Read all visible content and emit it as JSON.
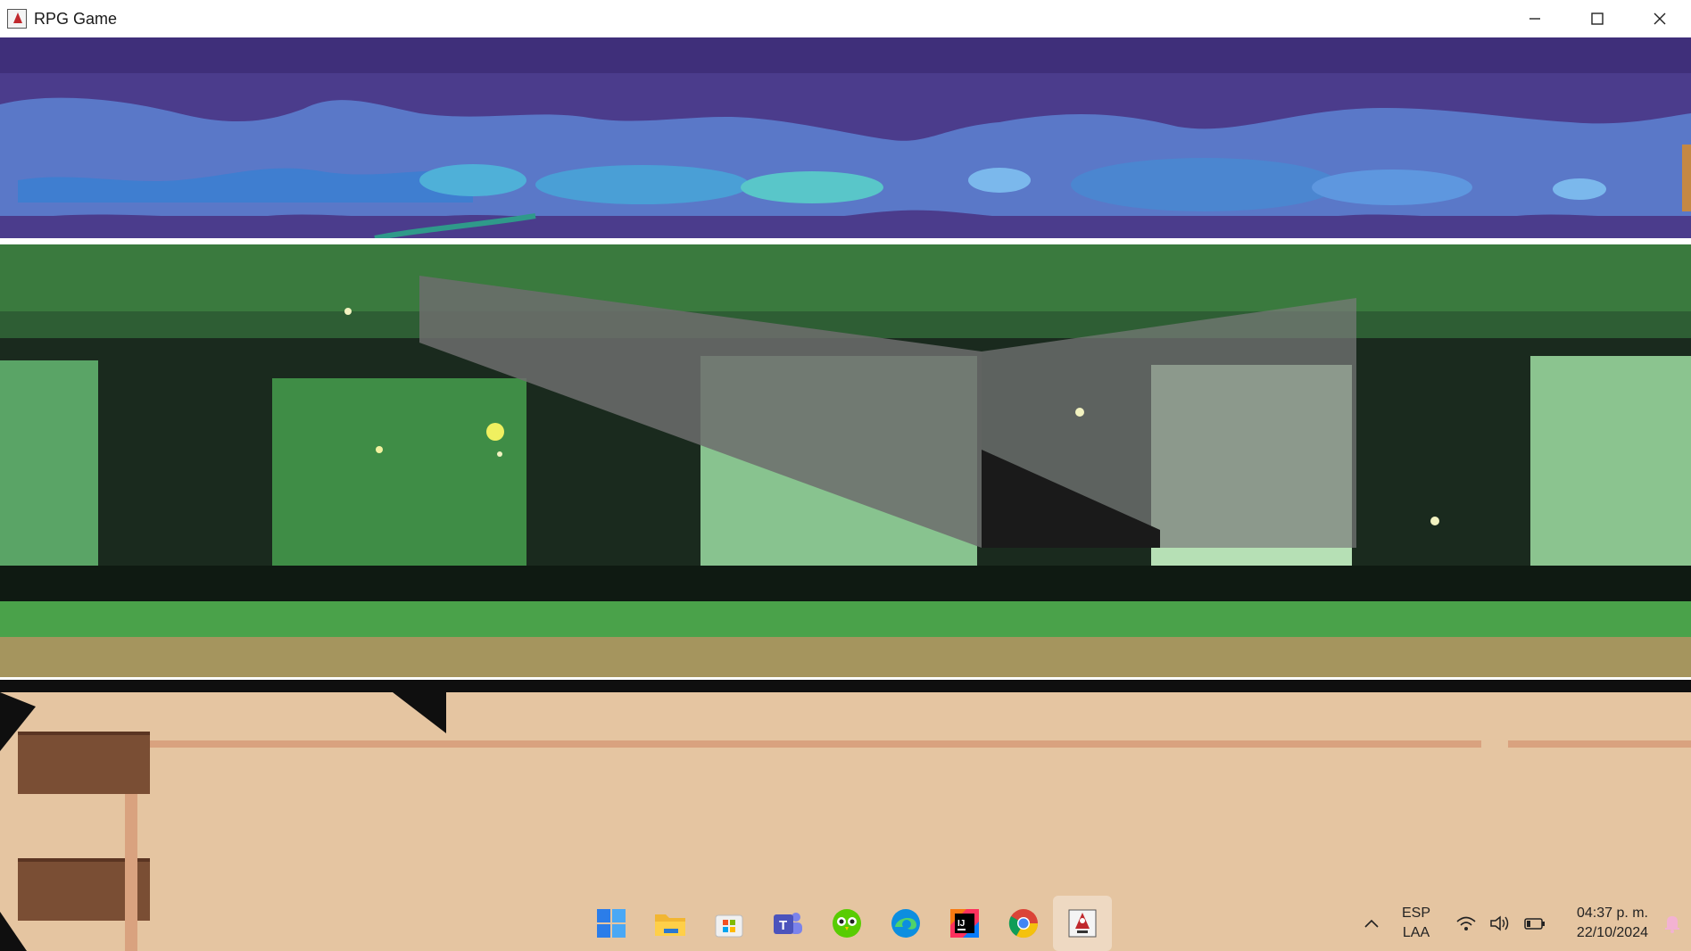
{
  "window": {
    "title": "RPG Game",
    "controls": [
      "minimize-icon",
      "maximize-icon",
      "close-icon"
    ]
  },
  "colors": {
    "cave_sky": "#4b3c8c",
    "cave_water": "#3f7ed0",
    "forest_canopy": "#3a7a3e",
    "forest_dark": "#111a14",
    "forest_light": "#a9d4a9",
    "forest_grass": "#4aa24a",
    "wood_board": "#e5c5a1",
    "wood_plank": "#7a4e34"
  },
  "taskbar": {
    "apps": [
      {
        "name": "start-icon",
        "label": "Start"
      },
      {
        "name": "file-explorer-icon",
        "label": "File Explorer"
      },
      {
        "name": "microsoft-store-icon",
        "label": "Microsoft Store"
      },
      {
        "name": "teams-icon",
        "label": "Teams"
      },
      {
        "name": "duolingo-icon",
        "label": "Duolingo"
      },
      {
        "name": "edge-icon",
        "label": "Edge"
      },
      {
        "name": "intellij-icon",
        "label": "IntelliJ IDEA"
      },
      {
        "name": "chrome-icon",
        "label": "Chrome"
      },
      {
        "name": "java-app-icon",
        "label": "RPG Game"
      }
    ],
    "tray": {
      "lang_line1": "ESP",
      "lang_line2": "LAA",
      "time": "04:37 p. m.",
      "date": "22/10/2024"
    }
  }
}
